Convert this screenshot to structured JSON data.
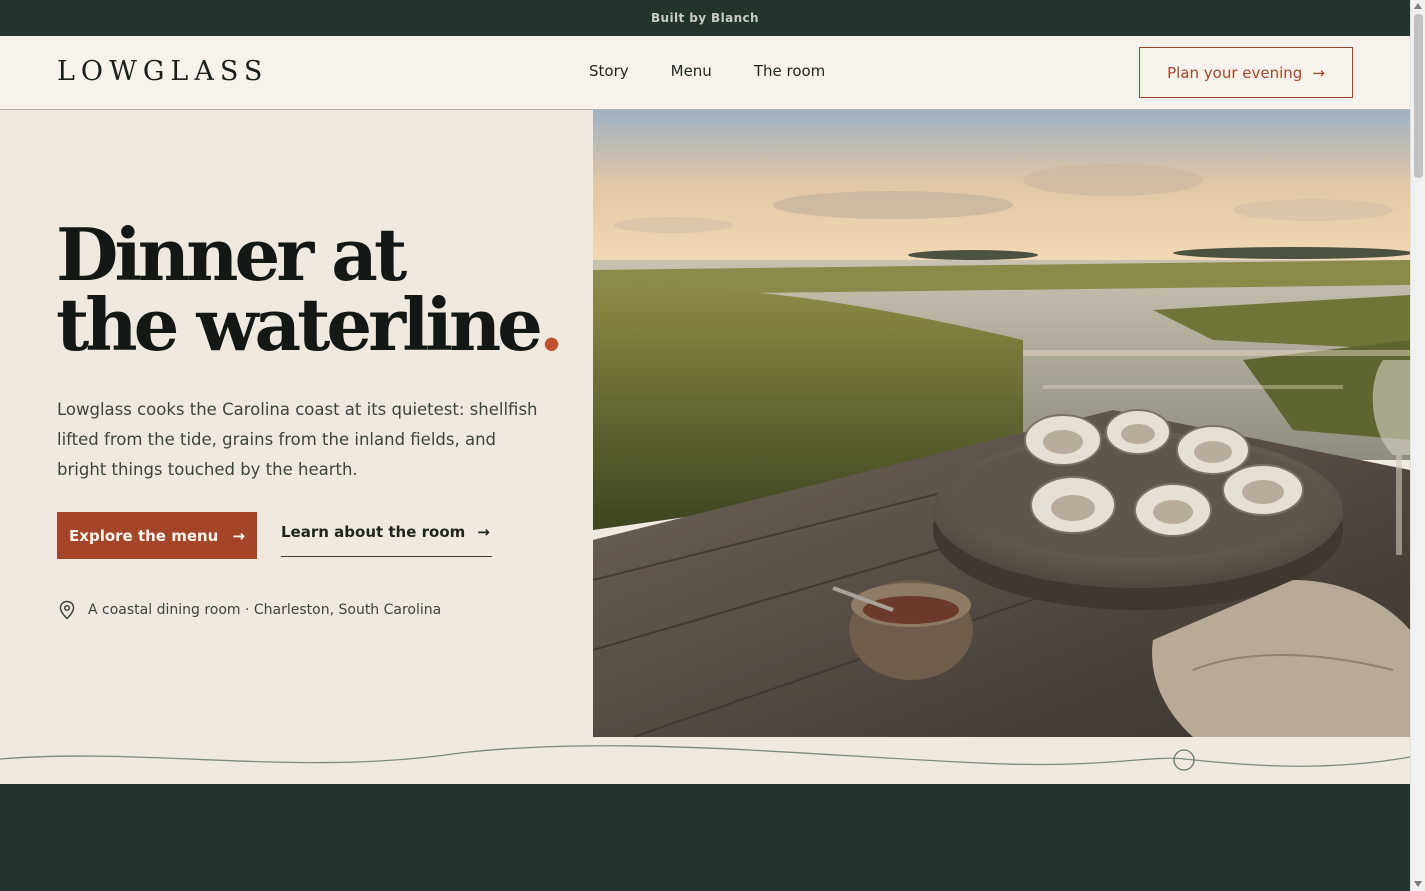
{
  "banner": {
    "text": "Built by Blanch"
  },
  "header": {
    "logo": "LOWGLASS",
    "nav": [
      "Story",
      "Menu",
      "The room"
    ],
    "cta_label": "Plan your evening"
  },
  "hero": {
    "headline_line1": "Dinner at",
    "headline_line2": "the waterline",
    "headline_dot": ".",
    "intro": "Lowglass cooks the Carolina coast at its quietest: shellfish lifted from the tide, grains from the inland fields, and bright things touched by the hearth.",
    "primary_button": "Explore the menu",
    "secondary_link": "Learn about the room",
    "location": "A coastal dining room · Charleston, South Carolina",
    "arrow": "→"
  },
  "icons": {
    "location": "map-pin-icon",
    "arrow": "arrow-right-icon"
  },
  "colors": {
    "dark_green": "#22342b",
    "cream": "#efe9df",
    "rust": "#a4452a",
    "accent_dot": "#c0532f"
  }
}
